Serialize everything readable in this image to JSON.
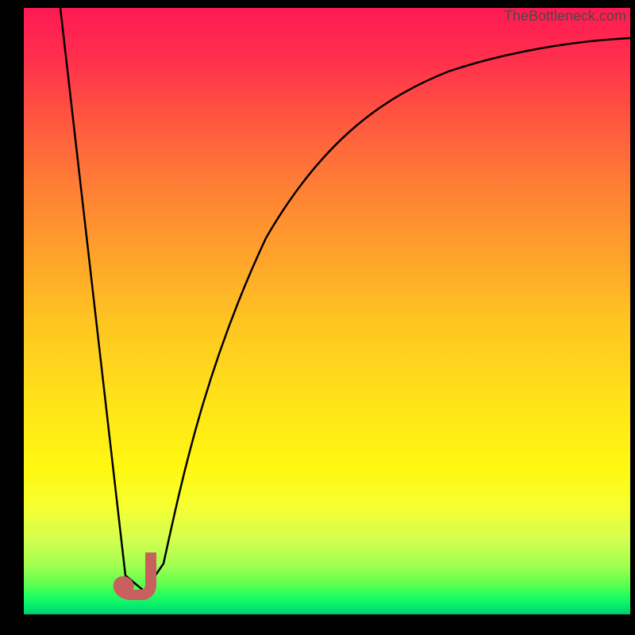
{
  "watermark": {
    "text": "TheBottleneck.com"
  },
  "chart_data": {
    "type": "line",
    "title": "",
    "xlabel": "",
    "ylabel": "",
    "xlim": [
      0,
      100
    ],
    "ylim": [
      0,
      100
    ],
    "series": [
      {
        "name": "bottleneck-curve",
        "description": "V-shaped bottleneck curve with rising asymptotic tail",
        "x": [
          6,
          16,
          20,
          23,
          30,
          40,
          50,
          60,
          70,
          80,
          90,
          100
        ],
        "y": [
          100,
          6,
          4,
          8,
          38,
          62,
          76,
          84,
          89,
          92,
          94,
          95
        ]
      }
    ],
    "marker": {
      "description": "J-shaped red marker at curve minimum",
      "x_position": 18,
      "y_position": 4,
      "color": "#c96060"
    },
    "gradient": {
      "description": "Vertical gradient from red (top/bad) through orange/yellow to green (bottom/good)",
      "stops": [
        {
          "pos": 0,
          "color": "#ff1a52"
        },
        {
          "pos": 50,
          "color": "#ffc522"
        },
        {
          "pos": 100,
          "color": "#00c878"
        }
      ]
    }
  }
}
